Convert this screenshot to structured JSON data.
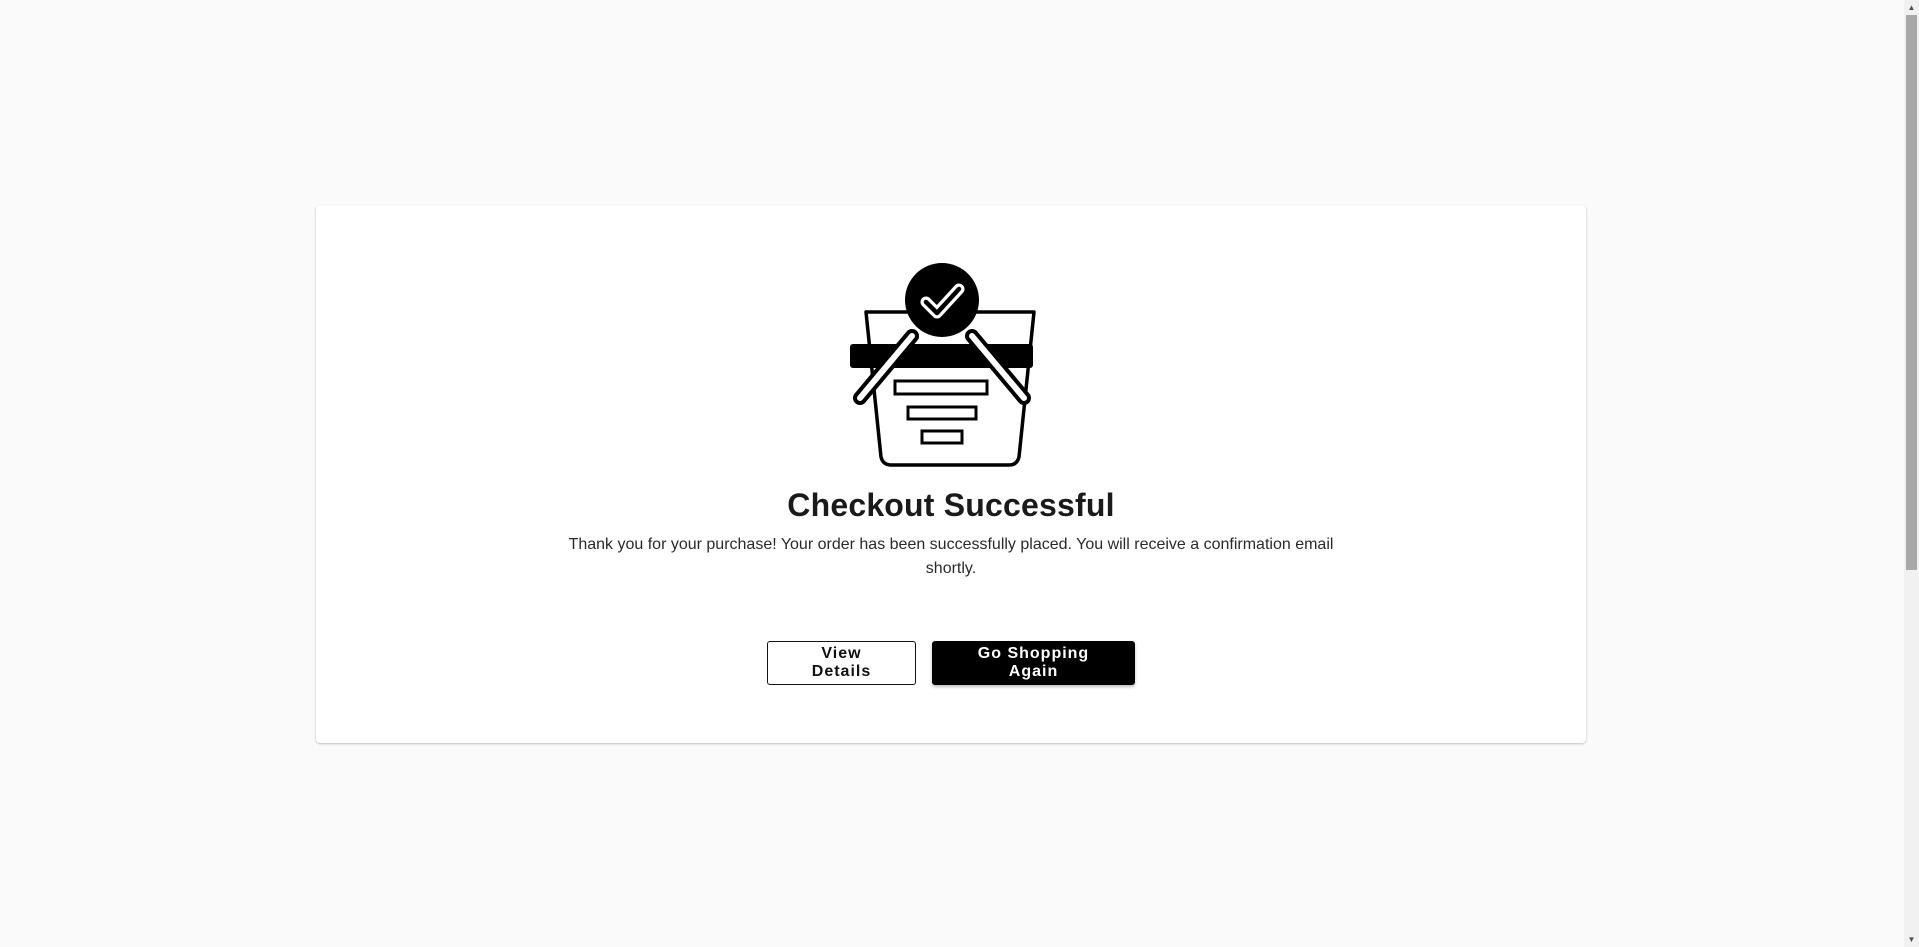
{
  "page": {
    "title": "Checkout Successful",
    "message": "Thank you for your purchase! Your order has been successfully placed. You will receive a confirmation email shortly."
  },
  "illustration": {
    "icon": "shopping-basket-check-icon"
  },
  "actions": {
    "view_details_label": "View Details",
    "go_shopping_label": "Go Shopping Again"
  },
  "scrollbar": {
    "up_glyph": "▲",
    "down_glyph": "▼"
  },
  "colors": {
    "background": "#fafafa",
    "card": "#ffffff",
    "primary": "#000000",
    "text": "#1a1a1a"
  }
}
